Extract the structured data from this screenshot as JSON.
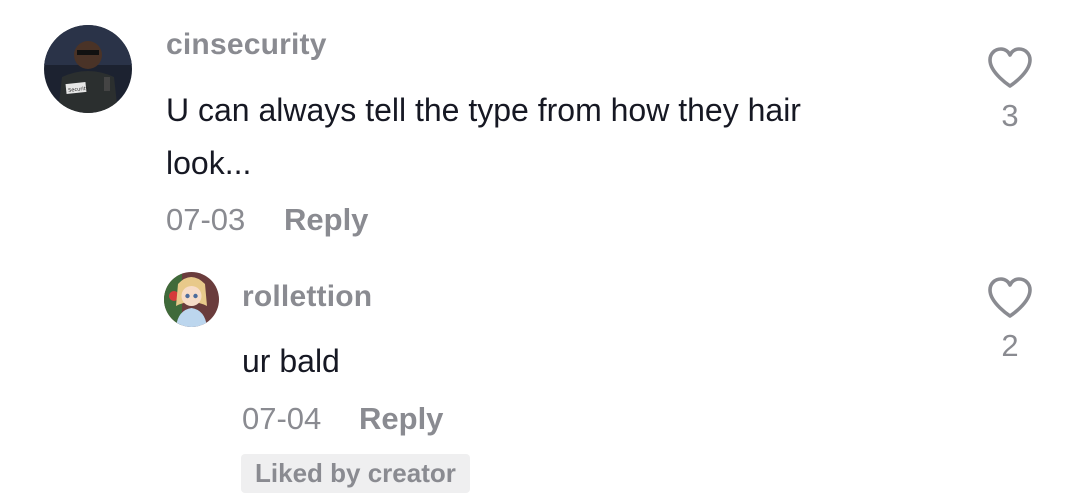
{
  "comments": [
    {
      "username": "cinsecurity",
      "text_line1": "U can always tell the type from how they hair",
      "text_line2": "look...",
      "date": "07-03",
      "reply_label": "Reply",
      "likes": "3",
      "avatar_icon": "user-avatar-security-guard",
      "avatar_badge_text": "Security",
      "replies": [
        {
          "username": "rollettion",
          "text": "ur bald",
          "date": "07-04",
          "reply_label": "Reply",
          "likes": "2",
          "avatar_icon": "user-avatar-anime-girl",
          "badge": "Liked by creator"
        }
      ]
    }
  ],
  "colors": {
    "muted": "#8a8b91",
    "text": "#161823",
    "badge_bg": "#efeff0"
  }
}
